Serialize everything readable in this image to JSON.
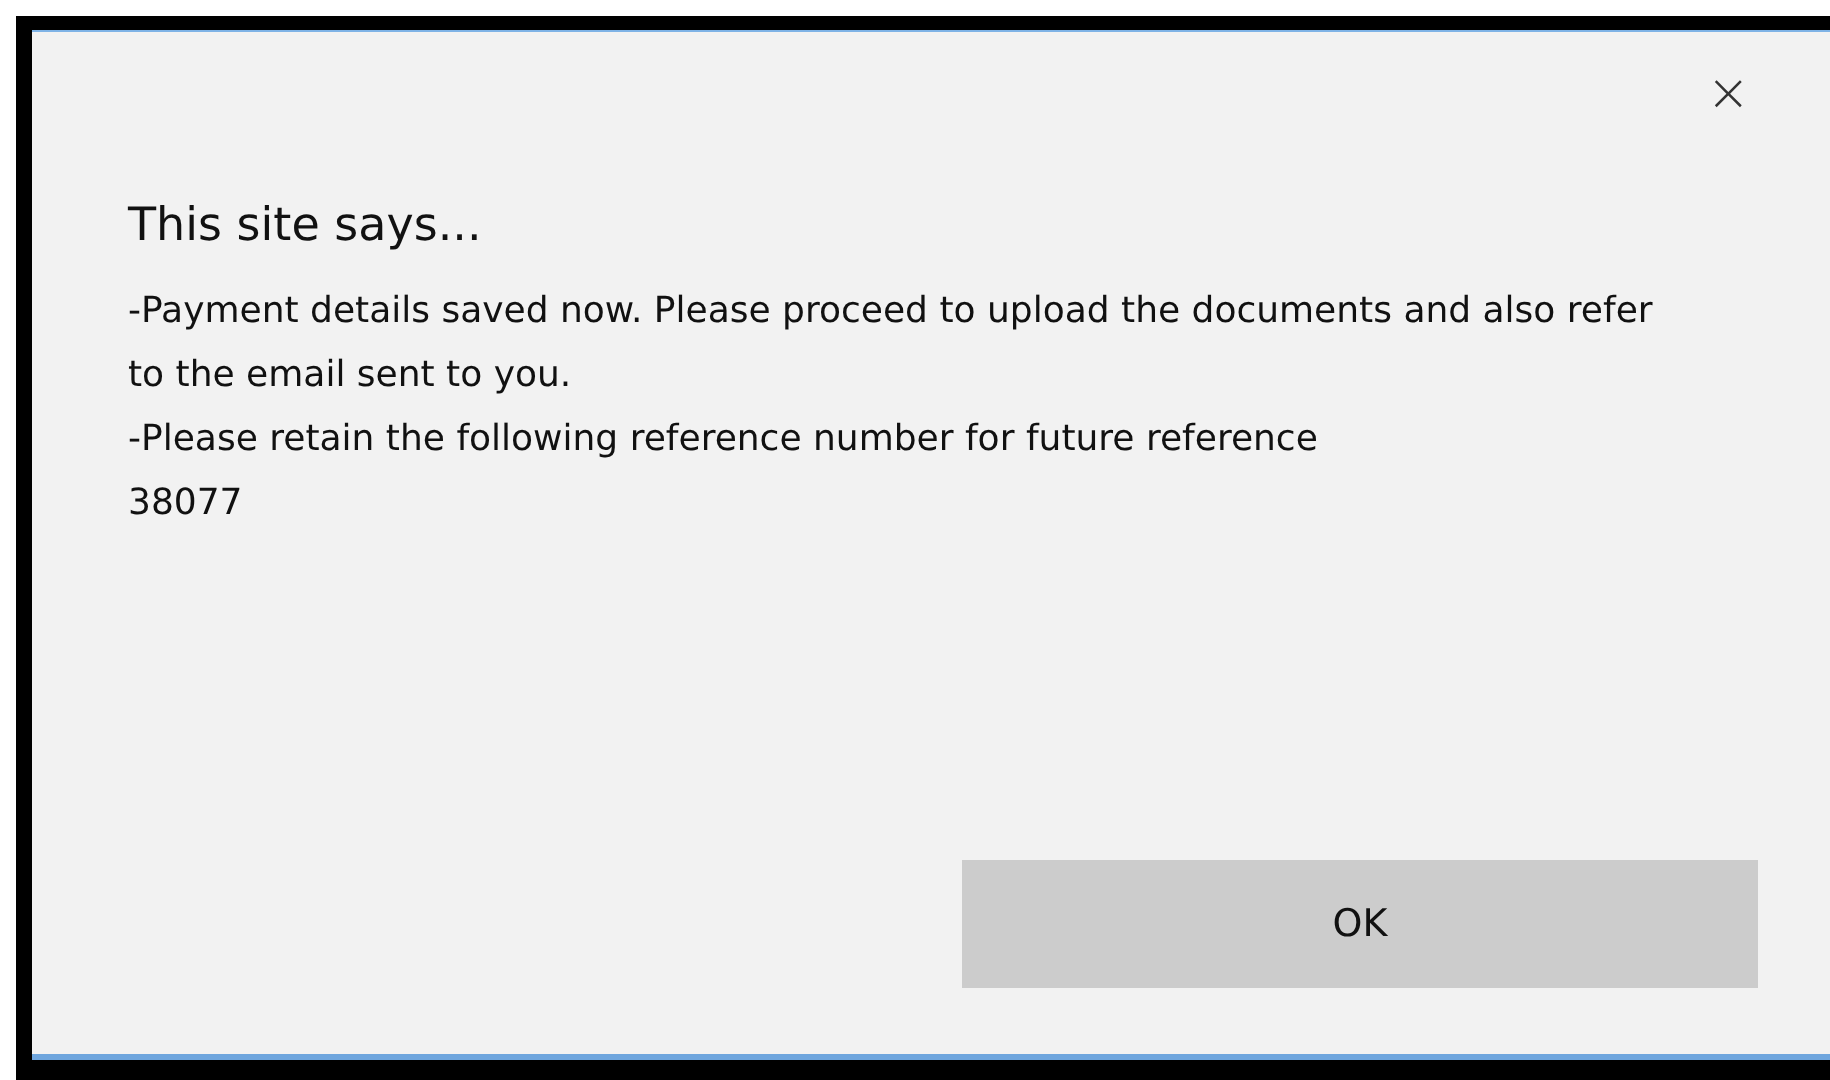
{
  "dialog": {
    "close": "×",
    "title": "This site says...",
    "messages": [
      "-Payment details saved now. Please proceed to upload the documents and also refer to the email sent to you.",
      "-Please retain the following reference number for future reference",
      "38077"
    ],
    "buttons": [
      "OK"
    ]
  }
}
